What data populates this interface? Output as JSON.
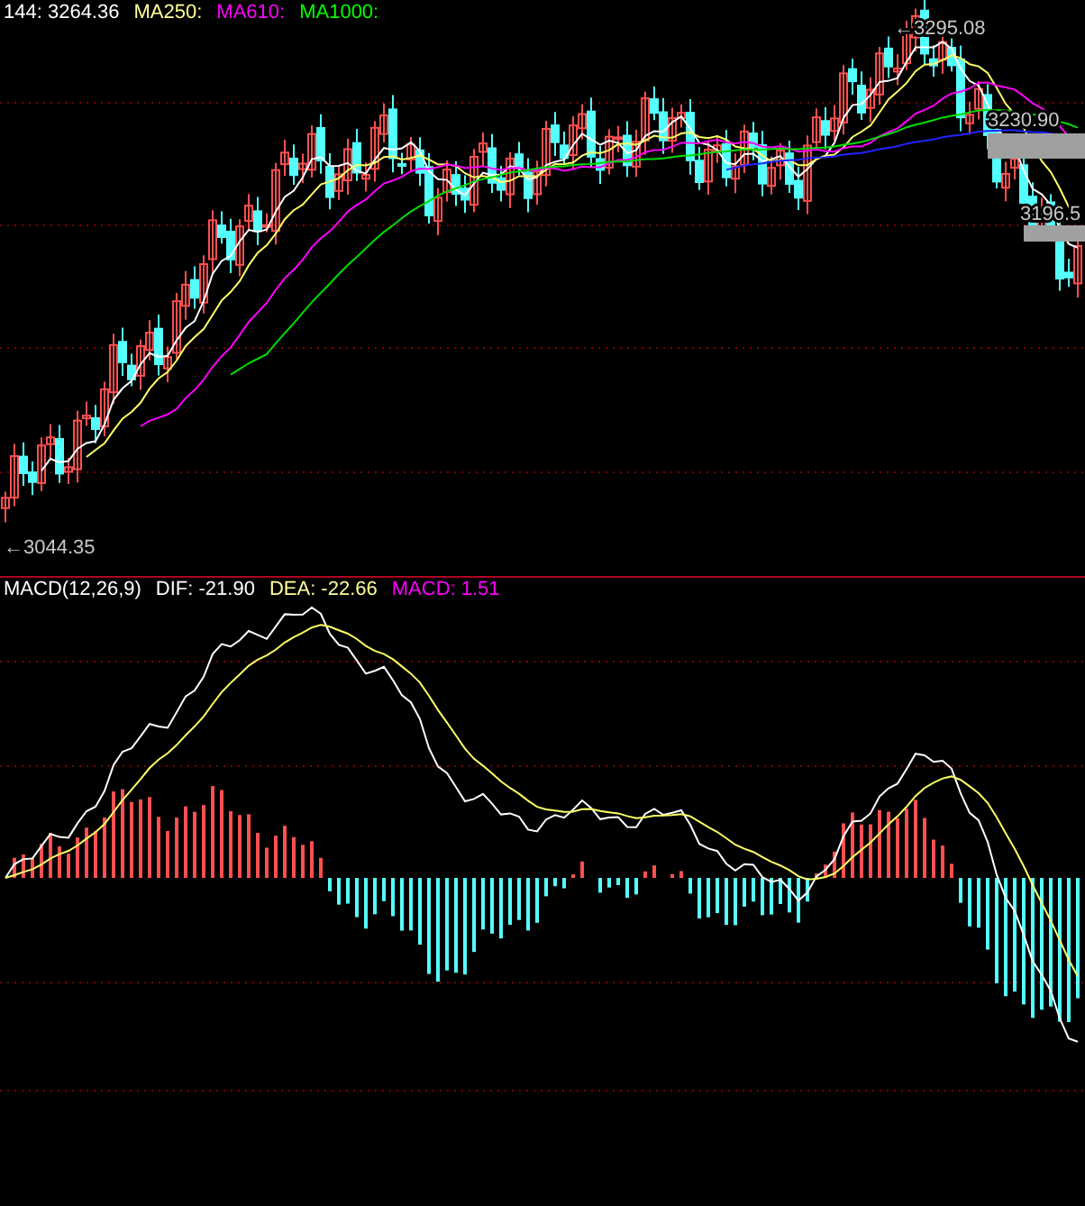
{
  "price_panel": {
    "legend": [
      {
        "text": "144: 3264.36",
        "color": "#ffffff"
      },
      {
        "text": "MA250:",
        "color": "#ffff99"
      },
      {
        "text": "MA610:",
        "color": "#ff00ff"
      },
      {
        "text": "MA1000:",
        "color": "#00ff00"
      }
    ],
    "high_label": "←3295.08",
    "low_label": "←3044.35",
    "price_tags": [
      "3230.90",
      "3196.5"
    ]
  },
  "macd_panel": {
    "legend": [
      {
        "text": "MACD(12,26,9)",
        "color": "#ffffff"
      },
      {
        "text": "DIF: -21.90",
        "color": "#ffffff"
      },
      {
        "text": "DEA: -22.66",
        "color": "#ffff99"
      },
      {
        "text": "MACD: 1.51",
        "color": "#ff00ff"
      }
    ]
  }
}
